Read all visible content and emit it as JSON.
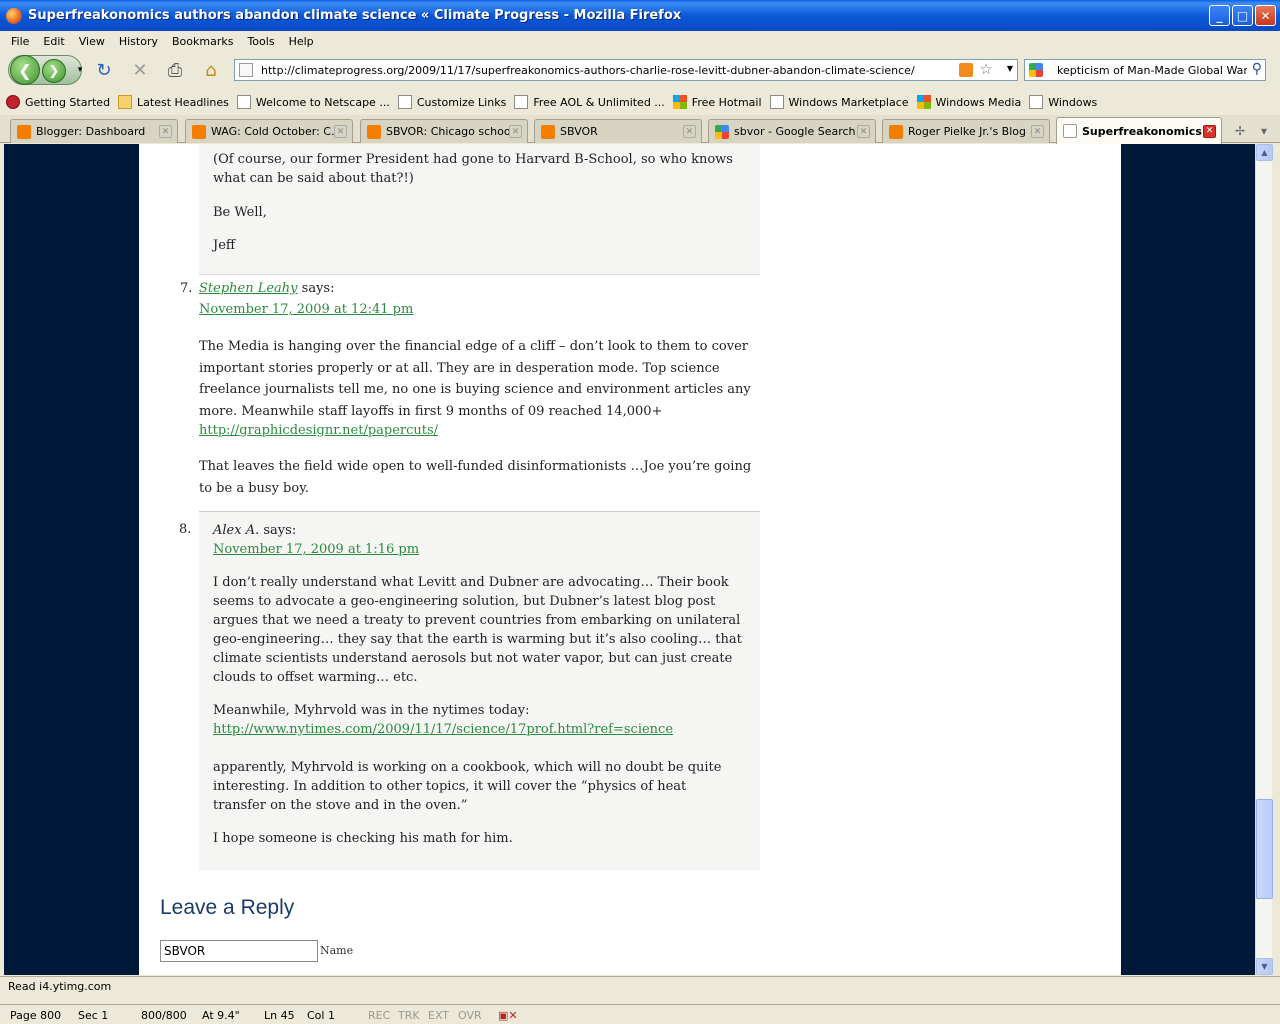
{
  "window": {
    "title": "Superfreakonomics authors abandon climate science « Climate Progress - Mozilla Firefox"
  },
  "menu": [
    "File",
    "Edit",
    "View",
    "History",
    "Bookmarks",
    "Tools",
    "Help"
  ],
  "address": {
    "url": "http://climateprogress.org/2009/11/17/superfreakonomics-authors-charlie-rose-levitt-dubner-abandon-climate-science/"
  },
  "search": {
    "value": "kepticism of Man-Made Global Warming"
  },
  "bookmarks": [
    {
      "label": "Getting Started",
      "icon": "red"
    },
    {
      "label": "Latest Headlines",
      "icon": "folder"
    },
    {
      "label": "Welcome to Netscape ...",
      "icon": "page"
    },
    {
      "label": "Customize Links",
      "icon": "page"
    },
    {
      "label": "Free AOL & Unlimited ...",
      "icon": "page"
    },
    {
      "label": "Free Hotmail",
      "icon": "win"
    },
    {
      "label": "Windows Marketplace",
      "icon": "page"
    },
    {
      "label": "Windows Media",
      "icon": "win"
    },
    {
      "label": "Windows",
      "icon": "page"
    }
  ],
  "tabs": [
    {
      "label": "Blogger: Dashboard"
    },
    {
      "label": "WAG: Cold October: C..."
    },
    {
      "label": "SBVOR: Chicago school..."
    },
    {
      "label": "SBVOR"
    },
    {
      "label": "sbvor - Google Search"
    },
    {
      "label": "Roger Pielke Jr.'s Blog"
    },
    {
      "label": "Superfreakonomics..."
    }
  ],
  "comments": {
    "c6": {
      "p1": "(Of course, our former President had gone to Harvard B-School, so who knows what can be said about that?!)",
      "p2": "Be Well,",
      "p3": "Jeff"
    },
    "c7": {
      "number": "7.",
      "author": "Stephen Leahy",
      "says": "says:",
      "date": "November 17, 2009 at 12:41 pm",
      "p1": "The Media is hanging over the financial edge of a cliff – don’t look to them to cover important stories properly or at all. They are in desperation mode. Top science freelance journalists tell me, no one is buying science and environment articles any more. Meanwhile staff layoffs in first 9 months of 09 reached 14,000+",
      "link": "http://graphicdesignr.net/papercuts/",
      "p2": "That leaves the field wide open to well-funded disinformationists …Joe you’re going to be a busy boy."
    },
    "c8": {
      "number": "8.",
      "author": "Alex A.",
      "says": "says:",
      "date": "November 17, 2009 at 1:16 pm",
      "p1": "I don’t really understand what Levitt and Dubner are advocating… Their book seems to advocate a geo-engineering solution, but Dubner’s latest blog post argues that we need a treaty to prevent countries from embarking on unilateral geo-engineering… they say that the earth is warming but it’s also cooling… that climate scientists understand aerosols but not water vapor, but can just create clouds to offset warming… etc.",
      "p2": "Meanwhile, Myhrvold was in the nytimes today:",
      "link": "http://www.nytimes.com/2009/11/17/science/17prof.html?ref=science",
      "p3": "apparently, Myhrvold is working on a cookbook, which will no doubt be quite interesting. In addition to other topics, it will cover the “physics of heat transfer on the stove and in the oven.”",
      "p4": "I hope someone is checking his math for him."
    }
  },
  "reply": {
    "heading": "Leave a Reply",
    "name_value": "SBVOR",
    "name_label": "Name"
  },
  "status": {
    "text": "Read i4.ytimg.com"
  },
  "word_status": {
    "page": "Page 800",
    "sec": "Sec 1",
    "pages": "800/800",
    "at": "At 9.4\"",
    "ln": "Ln 45",
    "col": "Col 1",
    "rec": "REC",
    "trk": "TRK",
    "ext": "EXT",
    "ovr": "OVR"
  }
}
